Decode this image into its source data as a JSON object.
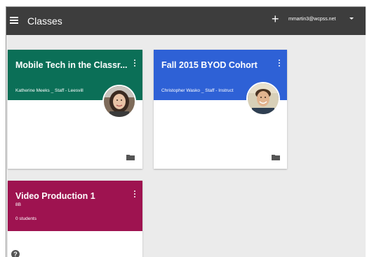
{
  "appbar": {
    "title": "Classes",
    "add_icon": "plus-icon",
    "account": "mmartin3@wcpss.net"
  },
  "classes": [
    {
      "title": "Mobile Tech in the Classr...",
      "subtitle": "Katherine Meeks _ Staff - Leesvill",
      "color": "#0b6f57",
      "icons": [
        "kebab-icon",
        "avatar",
        "folder-icon"
      ]
    },
    {
      "title": "Fall 2015 BYOD Cohort",
      "subtitle": "Christopher Wasko _ Staff - Instruct",
      "color": "#2e61d6",
      "icons": [
        "kebab-icon",
        "avatar",
        "folder-icon"
      ]
    },
    {
      "title": "Video Production 1",
      "section": "8B",
      "students": "0 students",
      "color": "#9e1350",
      "icons": [
        "kebab-icon"
      ]
    }
  ],
  "help_icon": "help-icon",
  "help_glyph": "?"
}
